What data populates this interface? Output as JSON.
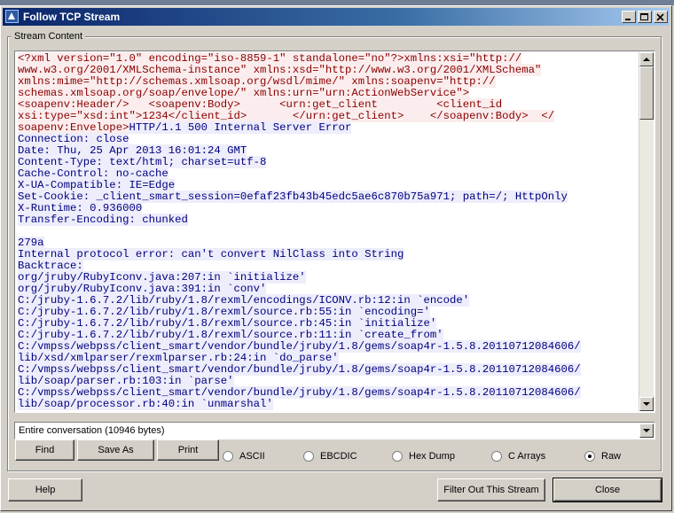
{
  "window": {
    "title": "Follow TCP Stream"
  },
  "group": {
    "label": "Stream Content"
  },
  "stream_lines": [
    {
      "dir": "client",
      "text": "<?xml version=\"1.0\" encoding=\"iso-8859-1\" standalone=\"no\"?>xmlns:xsi=\"http://"
    },
    {
      "dir": "client",
      "text": "www.w3.org/2001/XMLSchema-instance\" xmlns:xsd=\"http://www.w3.org/2001/XMLSchema\""
    },
    {
      "dir": "client",
      "text": "xmlns:mime=\"http://schemas.xmlsoap.org/wsdl/mime/\" xmlns:soapenv=\"http://"
    },
    {
      "dir": "client",
      "text": "schemas.xmlsoap.org/soap/envelope/\" xmlns:urn=\"urn:ActionWebService\">"
    },
    {
      "dir": "client",
      "text": "<soapenv:Header/>   <soapenv:Body>      <urn:get_client         <client_id"
    },
    {
      "dir": "client",
      "text": "xsi:type=\"xsd:int\">1234</client_id>       </urn:get_client>    </soapenv:Body>  </"
    },
    {
      "dir": "mixed",
      "client": "soapenv:Envelope>",
      "server": "HTTP/1.1 500 Internal Server Error"
    },
    {
      "dir": "server",
      "text": "Connection: close"
    },
    {
      "dir": "server",
      "text": "Date: Thu, 25 Apr 2013 16:01:24 GMT"
    },
    {
      "dir": "server",
      "text": "Content-Type: text/html; charset=utf-8"
    },
    {
      "dir": "server",
      "text": "Cache-Control: no-cache"
    },
    {
      "dir": "server",
      "text": "X-UA-Compatible: IE=Edge"
    },
    {
      "dir": "server",
      "text": "Set-Cookie: _client_smart_session=0efaf23fb43b45edc5ae6c870b75a971; path=/; HttpOnly"
    },
    {
      "dir": "server",
      "text": "X-Runtime: 0.936000"
    },
    {
      "dir": "server",
      "text": "Transfer-Encoding: chunked"
    },
    {
      "dir": "server",
      "text": ""
    },
    {
      "dir": "server",
      "text": "279a"
    },
    {
      "dir": "server",
      "text": "Internal protocol error: can't convert NilClass into String"
    },
    {
      "dir": "server",
      "text": "Backtrace:"
    },
    {
      "dir": "server",
      "text": "org/jruby/RubyIconv.java:207:in `initialize'"
    },
    {
      "dir": "server",
      "text": "org/jruby/RubyIconv.java:391:in `conv'"
    },
    {
      "dir": "server",
      "text": "C:/jruby-1.6.7.2/lib/ruby/1.8/rexml/encodings/ICONV.rb:12:in `encode'"
    },
    {
      "dir": "server",
      "text": "C:/jruby-1.6.7.2/lib/ruby/1.8/rexml/source.rb:55:in `encoding='"
    },
    {
      "dir": "server",
      "text": "C:/jruby-1.6.7.2/lib/ruby/1.8/rexml/source.rb:45:in `initialize'"
    },
    {
      "dir": "server",
      "text": "C:/jruby-1.6.7.2/lib/ruby/1.8/rexml/source.rb:11:in `create_from'"
    },
    {
      "dir": "server",
      "text": "C:/vmpss/webpss/client_smart/vendor/bundle/jruby/1.8/gems/soap4r-1.5.8.20110712084606/"
    },
    {
      "dir": "server",
      "text": "lib/xsd/xmlparser/rexmlparser.rb:24:in `do_parse'"
    },
    {
      "dir": "server",
      "text": "C:/vmpss/webpss/client_smart/vendor/bundle/jruby/1.8/gems/soap4r-1.5.8.20110712084606/"
    },
    {
      "dir": "server",
      "text": "lib/soap/parser.rb:103:in `parse'"
    },
    {
      "dir": "server",
      "text": "C:/vmpss/webpss/client_smart/vendor/bundle/jruby/1.8/gems/soap4r-1.5.8.20110712084606/"
    },
    {
      "dir": "server",
      "text": "lib/soap/processor.rb:40:in `unmarshal'"
    }
  ],
  "conversation_select": {
    "value": "Entire conversation (10946 bytes)"
  },
  "buttons": {
    "find": "Find",
    "save_as": "Save As",
    "print": "Print",
    "help": "Help",
    "filter_out": "Filter Out This Stream",
    "close": "Close"
  },
  "format_options": [
    {
      "label": "ASCII",
      "selected": false
    },
    {
      "label": "EBCDIC",
      "selected": false
    },
    {
      "label": "Hex Dump",
      "selected": false
    },
    {
      "label": "C Arrays",
      "selected": false
    },
    {
      "label": "Raw",
      "selected": true
    }
  ],
  "colors": {
    "client_text": "#8b0000",
    "client_bg": "#fbeded",
    "server_text": "#000080",
    "server_bg": "#ededfb",
    "title_bar": "#0a246a"
  }
}
